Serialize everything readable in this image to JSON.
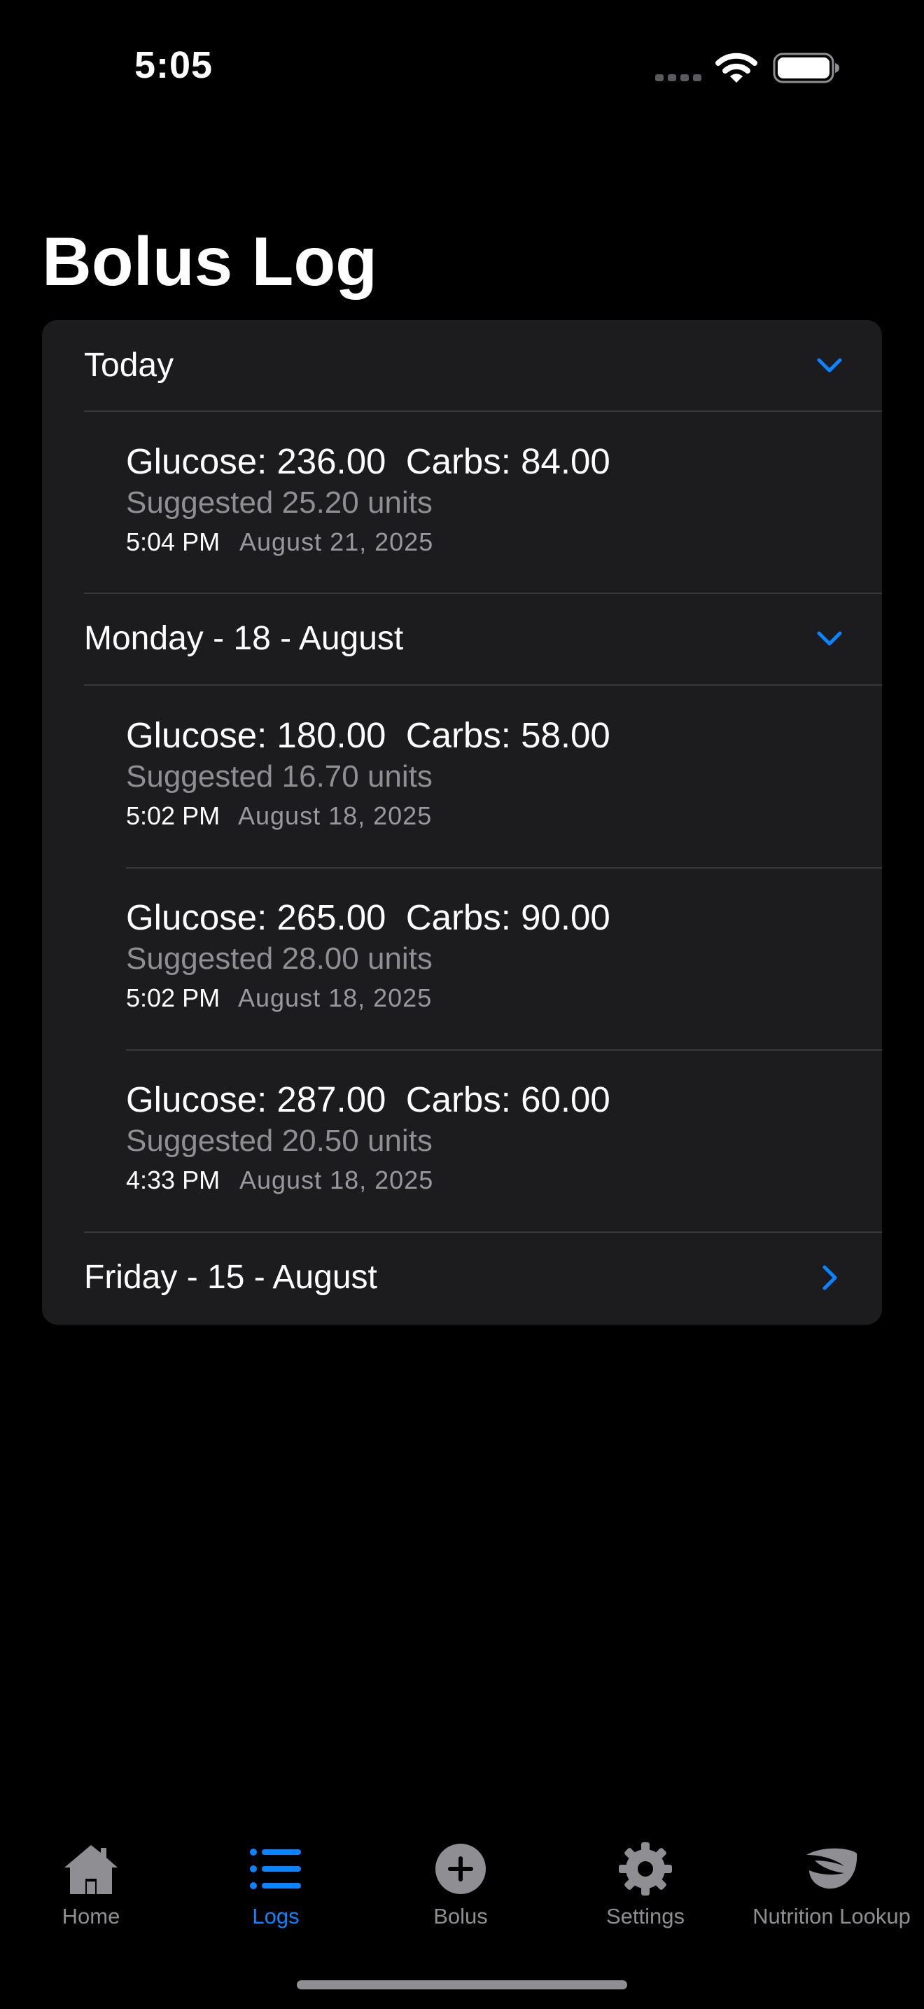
{
  "status_bar": {
    "time": "5:05"
  },
  "page": {
    "title": "Bolus Log"
  },
  "sections": [
    {
      "label": "Today",
      "expanded": true,
      "entries": [
        {
          "summary": "Glucose: 236.00  Carbs: 84.00",
          "suggested": "Suggested 25.20 units",
          "time": "5:04 PM",
          "date": "August 21, 2025"
        }
      ]
    },
    {
      "label": "Monday - 18 - August",
      "expanded": true,
      "entries": [
        {
          "summary": "Glucose: 180.00  Carbs: 58.00",
          "suggested": "Suggested 16.70 units",
          "time": "5:02 PM",
          "date": "August 18, 2025"
        },
        {
          "summary": "Glucose: 265.00  Carbs: 90.00",
          "suggested": "Suggested 28.00 units",
          "time": "5:02 PM",
          "date": "August 18, 2025"
        },
        {
          "summary": "Glucose: 287.00  Carbs: 60.00",
          "suggested": "Suggested 20.50 units",
          "time": "4:33 PM",
          "date": "August 18, 2025"
        }
      ]
    },
    {
      "label": "Friday - 15 - August",
      "expanded": false,
      "entries": []
    }
  ],
  "tab_bar": {
    "items": [
      {
        "label": "Home",
        "icon": "house-icon",
        "active": false
      },
      {
        "label": "Logs",
        "icon": "list-icon",
        "active": true
      },
      {
        "label": "Bolus",
        "icon": "plus-circle-icon",
        "active": false
      },
      {
        "label": "Settings",
        "icon": "gear-icon",
        "active": false
      },
      {
        "label": "Nutrition Lookup",
        "icon": "leaf-icon",
        "active": false
      }
    ]
  },
  "colors": {
    "accent": "#0a84ff",
    "background": "#000000",
    "card": "#1c1c1e",
    "secondary_text": "#8e8e93"
  }
}
